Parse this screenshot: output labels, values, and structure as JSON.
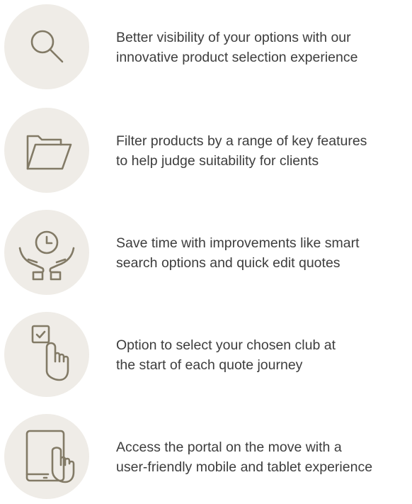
{
  "features": [
    {
      "icon": "magnifying-glass-icon",
      "text": "Better visibility of your options with our\ninnovative product selection experience"
    },
    {
      "icon": "folder-icon",
      "text": "Filter products by a range of key features\nto help judge suitability for clients"
    },
    {
      "icon": "hands-holding-clock-icon",
      "text": "Save time with improvements like smart\nsearch options and quick edit quotes"
    },
    {
      "icon": "finger-pressing-checkbox-icon",
      "text": "Option to select your chosen club at\nthe start of each quote journey"
    },
    {
      "icon": "hand-on-tablet-icon",
      "text": "Access the portal on the move with a\nuser-friendly mobile and tablet experience"
    }
  ],
  "colors": {
    "icon_circle_background": "#efece7",
    "icon_stroke": "#827a66",
    "text": "#3d3d3d"
  }
}
